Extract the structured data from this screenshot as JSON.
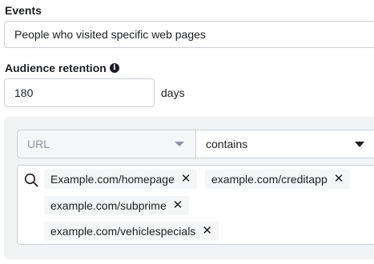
{
  "events": {
    "label": "Events",
    "selected": "People who visited specific web pages"
  },
  "retention": {
    "label": "Audience retention",
    "info_icon": "info-icon",
    "value": "180",
    "unit": "days"
  },
  "rule": {
    "field_selected": "URL",
    "operator_selected": "contains",
    "search_icon": "search-icon",
    "tags": [
      {
        "text": "Example.com/homepage"
      },
      {
        "text": "example.com/creditapp"
      },
      {
        "text": "example.com/subprime"
      },
      {
        "text": "example.com/vehiclespecials"
      }
    ],
    "remove_glyph": "✕"
  }
}
